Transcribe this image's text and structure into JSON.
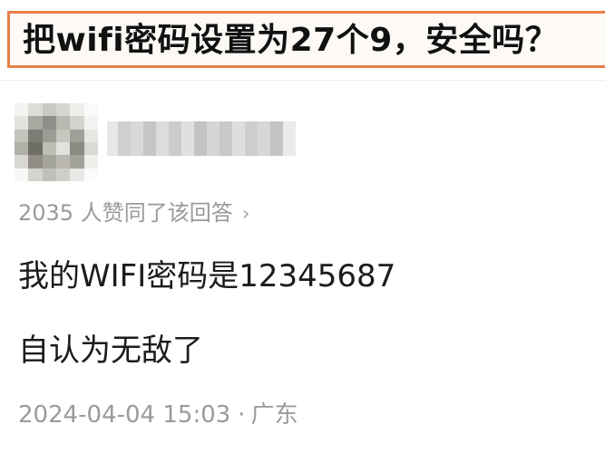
{
  "question": {
    "title": "把wifi密码设置为27个9，安全吗？"
  },
  "answer": {
    "vote_text": "2035 人赞同了该回答",
    "vote_chevron": "›",
    "lines": [
      "我的WIFI密码是12345687",
      "自认为无敌了"
    ],
    "date": "2024-04-04 15:03",
    "separator": "·",
    "location": "广东"
  },
  "colors": {
    "banner_border": "#e9804b",
    "meta_text": "#9a9a9a",
    "body_text": "#1c1c1c"
  }
}
